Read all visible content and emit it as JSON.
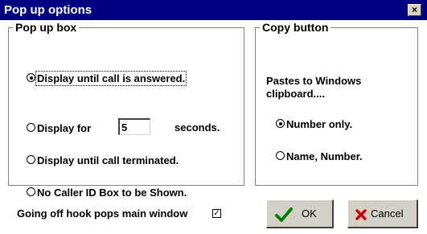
{
  "window": {
    "title": "Pop up options",
    "close_glyph": "×"
  },
  "popup_box": {
    "title": "Pop up box",
    "options": [
      {
        "label": "Display until call is answered.",
        "checked": true
      },
      {
        "label_before": "Display for",
        "seconds": "5",
        "label_after": "seconds.",
        "checked": false
      },
      {
        "label": "Display until call terminated.",
        "checked": false
      },
      {
        "label": "No Caller ID Box to be Shown.",
        "checked": false
      }
    ]
  },
  "copy_button": {
    "title": "Copy button",
    "description_line1": "Pastes to Windows",
    "description_line2": "clipboard....",
    "options": [
      {
        "label": "Number only.",
        "checked": true
      },
      {
        "label": "Name, Number.",
        "checked": false
      }
    ]
  },
  "offhook": {
    "label": "Going off hook pops main window",
    "checked": true,
    "check_glyph": "✓"
  },
  "buttons": {
    "ok_label": "OK",
    "ok_icon": "check-icon",
    "ok_icon_color": "#008000",
    "cancel_label": "Cancel",
    "cancel_icon": "x-icon",
    "cancel_icon_color": "#cc0000"
  },
  "colors": {
    "titlebar": "#000080",
    "window_face": "#d4d0c8"
  }
}
